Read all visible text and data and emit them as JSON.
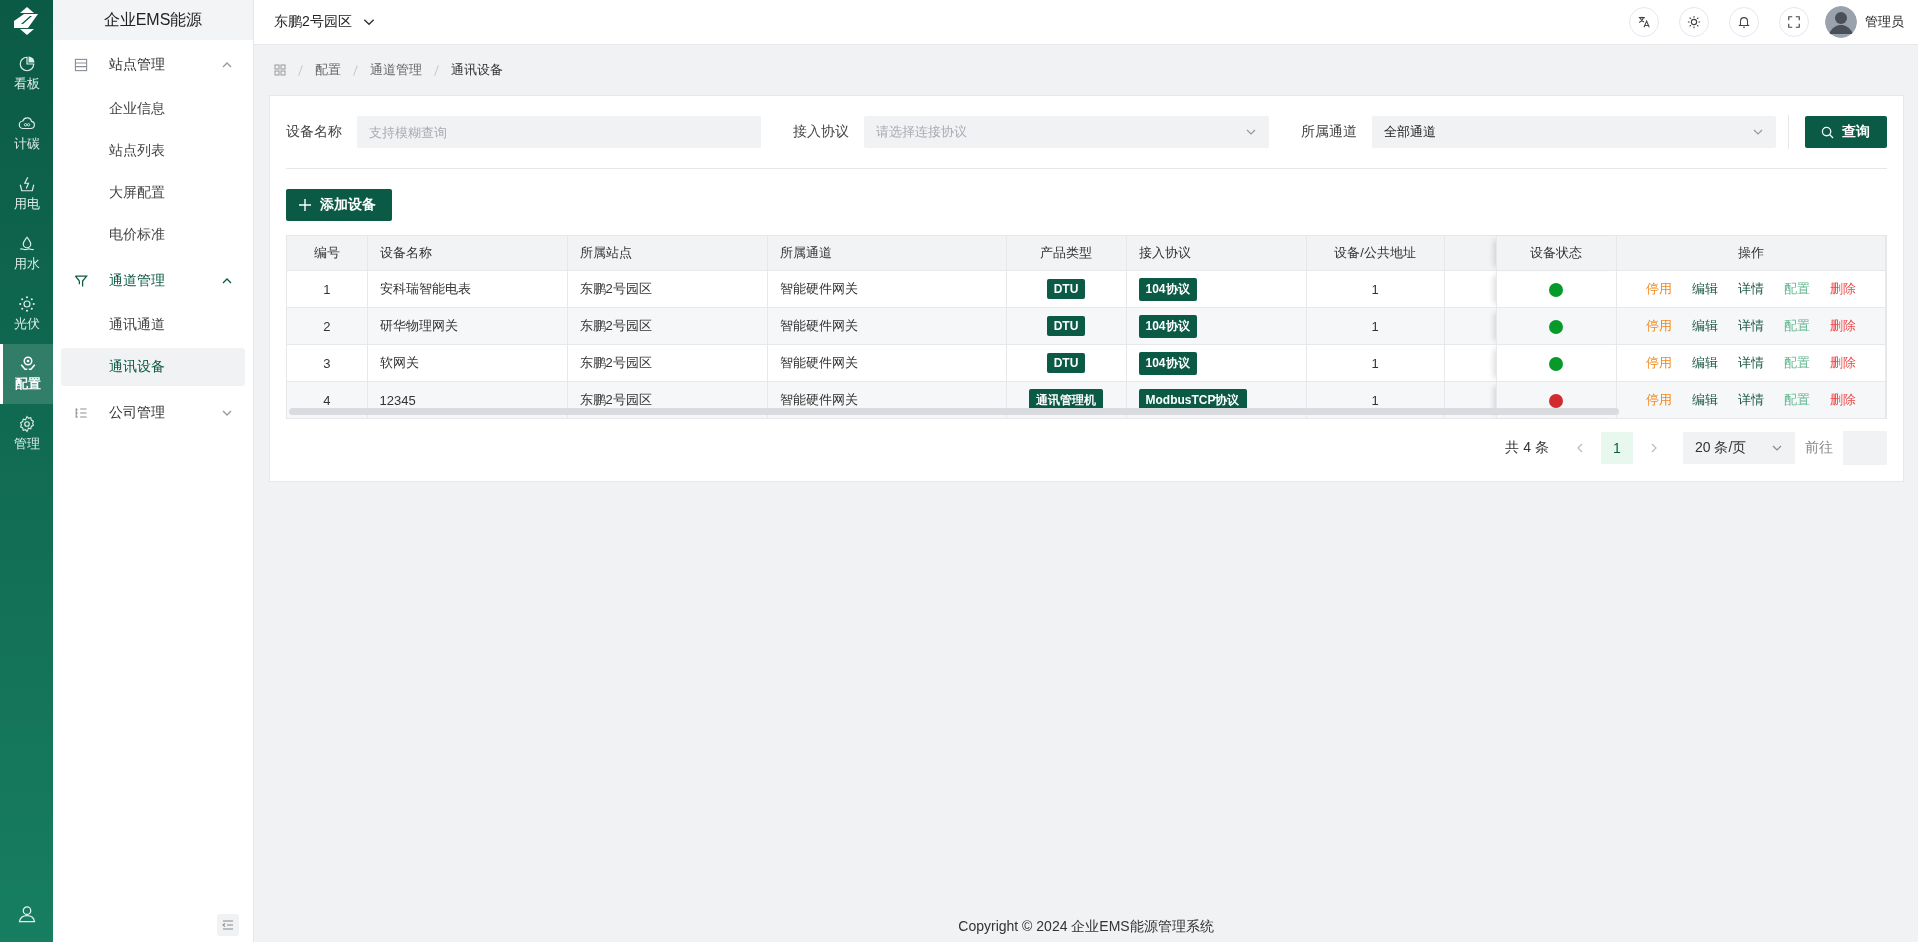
{
  "rail": {
    "items": [
      {
        "label": "看板",
        "selected": false
      },
      {
        "label": "计碳",
        "selected": false
      },
      {
        "label": "用电",
        "selected": false
      },
      {
        "label": "用水",
        "selected": false
      },
      {
        "label": "光伏",
        "selected": false
      },
      {
        "label": "配置",
        "selected": true
      },
      {
        "label": "管理",
        "selected": false
      }
    ]
  },
  "sidebar": {
    "title": "企业EMS能源",
    "groups": [
      {
        "label": "站点管理",
        "expanded": true,
        "selected": false,
        "children": [
          {
            "label": "企业信息",
            "selected": false
          },
          {
            "label": "站点列表",
            "selected": false
          },
          {
            "label": "大屏配置",
            "selected": false
          },
          {
            "label": "电价标准",
            "selected": false
          }
        ]
      },
      {
        "label": "通道管理",
        "expanded": true,
        "selected": true,
        "children": [
          {
            "label": "通讯通道",
            "selected": false
          },
          {
            "label": "通讯设备",
            "selected": true
          }
        ]
      },
      {
        "label": "公司管理",
        "expanded": false,
        "selected": false
      }
    ]
  },
  "header": {
    "site": "东鹏2号园区",
    "user": "管理员"
  },
  "breadcrumb": [
    "配置",
    "通道管理",
    "通讯设备"
  ],
  "filters": [
    {
      "label": "设备名称",
      "kind": "text",
      "placeholder": "支持模糊查询"
    },
    {
      "label": "接入协议",
      "kind": "select",
      "placeholder": "请选择连接协议"
    },
    {
      "label": "所属通道",
      "kind": "select",
      "value": "全部通道"
    }
  ],
  "search_button": "查询",
  "add_button": "添加设备",
  "table": {
    "columns": [
      "编号",
      "设备名称",
      "所属站点",
      "所属通道",
      "产品类型",
      "接入协议",
      "设备/公共地址",
      "设备状态",
      "操作"
    ],
    "rows": [
      {
        "no": "1",
        "name": "安科瑞智能电表",
        "site": "东鹏2号园区",
        "channel": "智能硬件网关",
        "product_type": "DTU",
        "protocol": "104协议",
        "address": "1",
        "color": "#079a2b",
        "actions": [
          {
            "label": "停用",
            "kind": "warning"
          },
          {
            "label": "编辑",
            "kind": "primary"
          },
          {
            "label": "详情",
            "kind": "primary"
          },
          {
            "label": "配置",
            "kind": "light"
          },
          {
            "label": "删除",
            "kind": "danger"
          }
        ]
      },
      {
        "no": "2",
        "name": "研华物理网关",
        "site": "东鹏2号园区",
        "channel": "智能硬件网关",
        "product_type": "DTU",
        "protocol": "104协议",
        "address": "1",
        "color": "#079a2b",
        "actions": [
          {
            "label": "停用",
            "kind": "warning"
          },
          {
            "label": "编辑",
            "kind": "primary"
          },
          {
            "label": "详情",
            "kind": "primary"
          },
          {
            "label": "配置",
            "kind": "light"
          },
          {
            "label": "删除",
            "kind": "danger"
          }
        ]
      },
      {
        "no": "3",
        "name": "软网关",
        "site": "东鹏2号园区",
        "channel": "智能硬件网关",
        "product_type": "DTU",
        "protocol": "104协议",
        "address": "1",
        "color": "#079a2b",
        "actions": [
          {
            "label": "停用",
            "kind": "warning"
          },
          {
            "label": "编辑",
            "kind": "primary"
          },
          {
            "label": "详情",
            "kind": "primary"
          },
          {
            "label": "配置",
            "kind": "light"
          },
          {
            "label": "删除",
            "kind": "danger"
          }
        ]
      },
      {
        "no": "4",
        "name": "12345",
        "site": "东鹏2号园区",
        "channel": "智能硬件网关",
        "product_type": "通讯管理机",
        "protocol": "ModbusTCP协议",
        "address": "1",
        "color": "#d12a2f",
        "actions": [
          {
            "label": "停用",
            "kind": "warning"
          },
          {
            "label": "编辑",
            "kind": "primary"
          },
          {
            "label": "详情",
            "kind": "primary"
          },
          {
            "label": "配置",
            "kind": "light"
          },
          {
            "label": "删除",
            "kind": "danger"
          }
        ]
      }
    ]
  },
  "pagination": {
    "total": "共 4 条",
    "pages": [
      {
        "label": "1",
        "selected": true
      }
    ],
    "page_size": "20 条/页",
    "goto": "前往"
  },
  "footer": "Copyright © 2024 企业EMS能源管理系统"
}
